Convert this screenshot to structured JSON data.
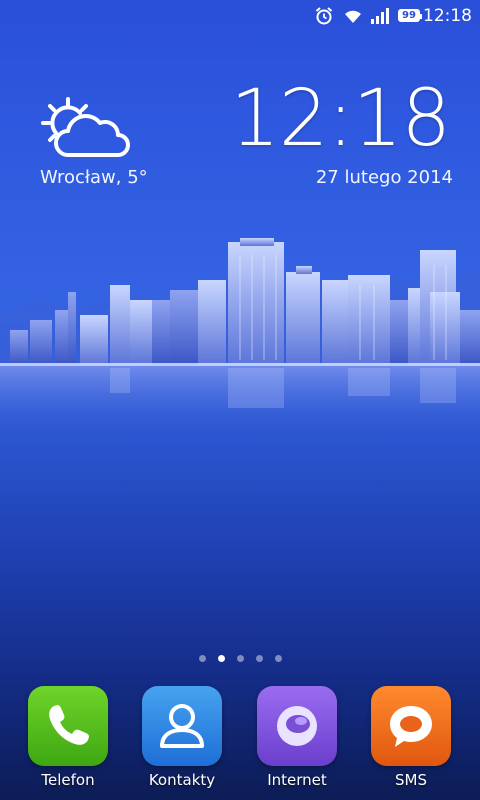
{
  "status_bar": {
    "time": "12:18",
    "battery_level": "99",
    "icons": [
      "alarm-icon",
      "wifi-icon",
      "signal-icon",
      "battery-icon"
    ]
  },
  "weather": {
    "location_temp": "Wrocław, 5°",
    "icon": "partly-cloudy-icon"
  },
  "clock": {
    "time": "12:18",
    "date": "27 lutego 2014"
  },
  "pager": {
    "pages": 5,
    "active_index": 1
  },
  "dock": {
    "apps": [
      {
        "label": "Telefon",
        "icon": "phone-icon",
        "color": "#4cb51c"
      },
      {
        "label": "Kontakty",
        "icon": "contacts-icon",
        "color": "#2f86e0"
      },
      {
        "label": "Internet",
        "icon": "browser-icon",
        "color": "#7a4fd6"
      },
      {
        "label": "SMS",
        "icon": "sms-icon",
        "color": "#f06a17"
      }
    ]
  }
}
